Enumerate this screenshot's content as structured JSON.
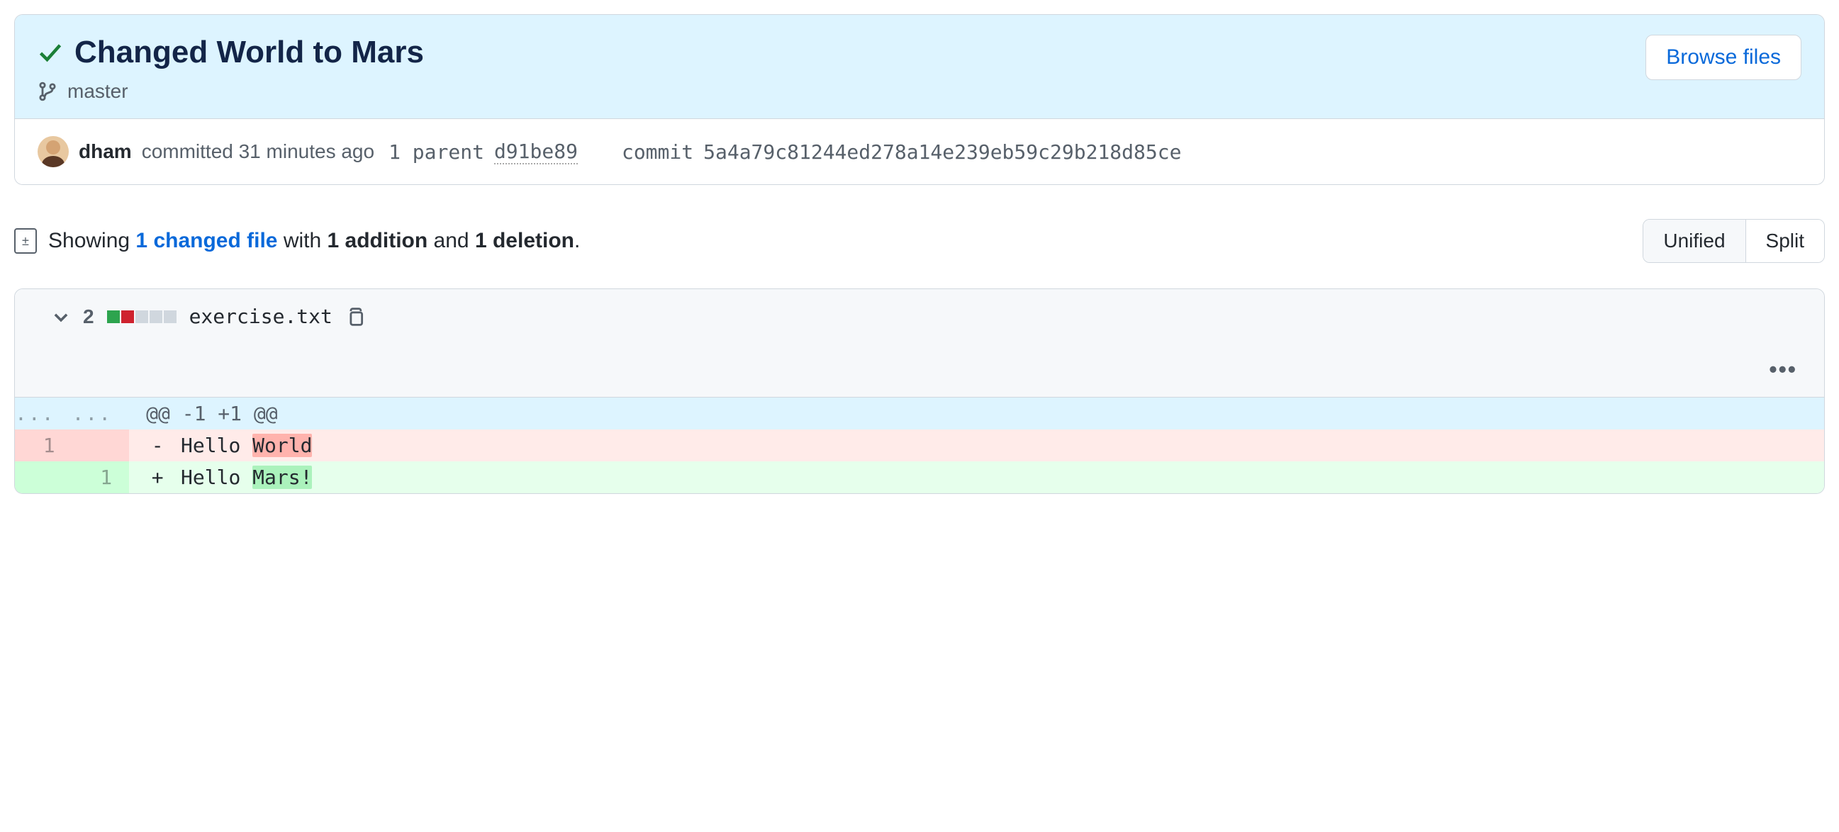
{
  "commit": {
    "title": "Changed World to Mars",
    "branch": "master",
    "browse_label": "Browse files",
    "author": "dham",
    "committed_text": "committed 31 minutes ago",
    "parent_count": "1",
    "parent_label": "parent",
    "parent_sha": "d91be89",
    "commit_label": "commit",
    "full_sha": "5a4a79c81244ed278a14e239eb59c29b218d85ce"
  },
  "summary": {
    "showing": "Showing",
    "changed_files": "1 changed file",
    "with": "with",
    "additions": "1 addition",
    "and": "and",
    "deletions": "1 deletion",
    "period": "."
  },
  "toggle": {
    "unified": "Unified",
    "split": "Split"
  },
  "file": {
    "change_count": "2",
    "name": "exercise.txt",
    "hunk": "@@ -1 +1 @@",
    "del_linenum": "1",
    "add_linenum": "1",
    "del_prefix": "Hello ",
    "del_highlight": "World",
    "add_prefix": "Hello ",
    "add_highlight": "Mars!",
    "dots": "..."
  }
}
